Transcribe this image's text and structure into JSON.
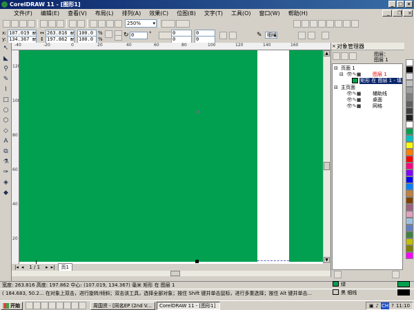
{
  "window": {
    "title": "CorelDRAW 11 - [图形1]"
  },
  "menu": [
    "文件(F)",
    "编辑(E)",
    "查看(V)",
    "布局(L)",
    "排列(A)",
    "效果(C)",
    "位图(B)",
    "文字(T)",
    "工具(O)",
    "窗口(W)",
    "帮助(H)"
  ],
  "toolbar": {
    "zoom": "250%",
    "rotation": "0",
    "outline_width": "细线",
    "skew1": "0",
    "skew2": "0"
  },
  "property_bar": {
    "x": "107.019 ㎜",
    "y": "134.367 ㎜",
    "w": "263.816 ㎜",
    "h": "197.862 ㎜",
    "scale_x": "100.0",
    "scale_y": "100.0",
    "pct": "%"
  },
  "ruler_h": [
    "-40",
    "-20",
    "0",
    "20",
    "40",
    "60",
    "80",
    "100",
    "120",
    "140",
    "160"
  ],
  "ruler_v": [
    "120",
    "100",
    "80",
    "60",
    "40",
    "20"
  ],
  "docker": {
    "title": "对象管理器",
    "layer_header_1": "图层：",
    "layer_header_2": "图层 1",
    "items": [
      {
        "label": "页面 1"
      },
      {
        "label": "图层 1"
      },
      {
        "label": "矩形 在 图层 1 - 填"
      },
      {
        "label": "主页面"
      },
      {
        "label": "辅助线"
      },
      {
        "label": "桌面"
      },
      {
        "label": "网格"
      }
    ]
  },
  "page_nav": {
    "counter": "1 / 1",
    "tab": "页1"
  },
  "status": {
    "line1": "宽度: 263.816  高度: 197.862  中心: (107.019, 134.367)  毫米          矩形 在 图层 1",
    "line2": "( 184.683, 50.2...   在对象上双击，进行旋转/倾斜；双击该工具，选择全部对象；按住 Shift 键并单击鼠标，进行多重选择；按住 Alt 键并单击...",
    "fill_label": "绿",
    "outline_label": "黑  细线"
  },
  "taskbar": {
    "start": "开始",
    "tasks": [
      "周国资 - [同名EP (2nd V...",
      "CorelDRAW 11 - [图形1]"
    ],
    "clock": "11:10",
    "ime": "CH"
  },
  "colors": {
    "fill": "#00a050",
    "accent": "#0a246a"
  },
  "palette": [
    "#ffffff",
    "#000000",
    "#e0e0e0",
    "#c0c0c0",
    "#a0a0a0",
    "#808080",
    "#606060",
    "#404040",
    "#202020",
    "#ffffff",
    "#00a050",
    "#00c0c0",
    "#ffff00",
    "#ff8000",
    "#ff0000",
    "#ff0080",
    "#8000ff",
    "#0000ff",
    "#0080ff",
    "#c08040",
    "#804000",
    "#a06080",
    "#e0a0c0",
    "#a0c0e0",
    "#6080c0",
    "#408040",
    "#c0c000",
    "#808000",
    "#ff00ff"
  ]
}
